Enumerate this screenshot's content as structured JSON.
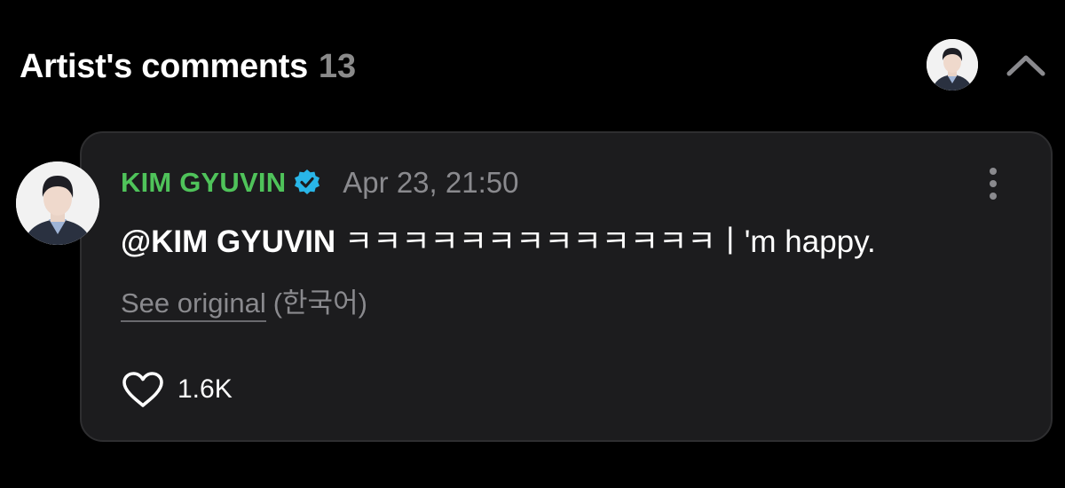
{
  "header": {
    "title": "Artist's comments",
    "count": "13"
  },
  "comment": {
    "author": "KIM GYUVIN",
    "timestamp": "Apr 23, 21:50",
    "mention": "@KIM GYUVIN",
    "body": " ㅋㅋㅋㅋㅋㅋㅋㅋㅋㅋㅋㅋㅋㅣ'm happy.",
    "see_original_label": "See original",
    "original_language": "(한국어)",
    "like_count": "1.6K"
  },
  "icons": {
    "collapse": "chevron-up-icon",
    "verified": "verified-badge-icon",
    "more": "more-vertical-icon",
    "like": "heart-outline-icon"
  },
  "colors": {
    "background": "#000000",
    "card": "#1c1c1e",
    "author_name": "#4fc35a",
    "verified_badge": "#29b6e8",
    "muted_text": "#8a8a8e"
  }
}
